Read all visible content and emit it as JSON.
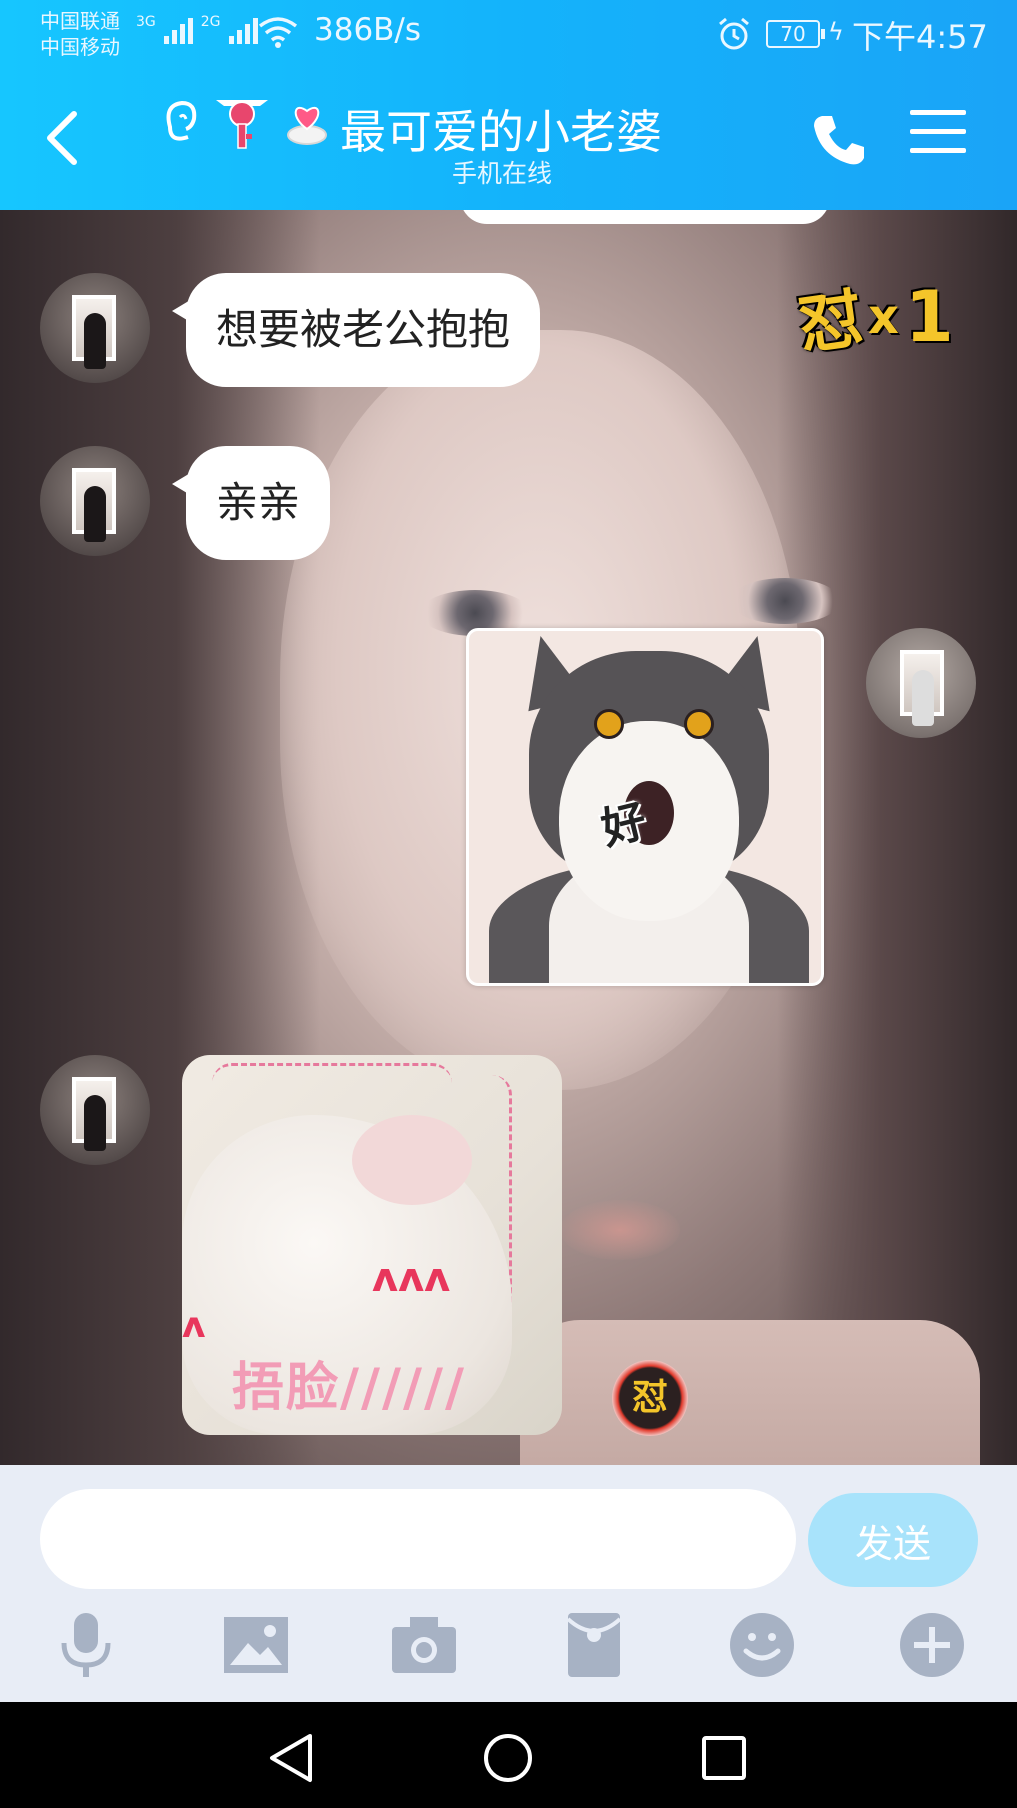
{
  "status_bar": {
    "carrier_1": "中国联通",
    "carrier_2": "中国移动",
    "network_1": "3G",
    "network_2": "2G",
    "net_speed": "386B/s",
    "battery": "70",
    "time": "下午4:57"
  },
  "header": {
    "title": "最可爱的小老婆",
    "subtitle": "手机在线",
    "badges": [
      "ear-badge-icon",
      "key-heart-badge-icon",
      "heart-ring-badge-icon"
    ],
    "accent_color": "#14b3fb"
  },
  "messages": [
    {
      "from": "contact",
      "type": "text",
      "text": "想要被老公抱抱"
    },
    {
      "from": "contact",
      "type": "text",
      "text": "亲亲"
    },
    {
      "from": "me",
      "type": "sticker",
      "caption": "好"
    },
    {
      "from": "contact",
      "type": "sticker",
      "caption": "捂脸//////"
    }
  ],
  "dui_badge": {
    "char": "怼",
    "multiplier": "x",
    "count": "1"
  },
  "dui_coin": {
    "char": "怼"
  },
  "input": {
    "placeholder": "",
    "value": "",
    "send_label": "发送"
  },
  "toolbar": [
    "microphone-icon",
    "image-icon",
    "camera-icon",
    "red-packet-icon",
    "emoji-icon",
    "plus-icon"
  ],
  "send_button_color": "#a8e3fb"
}
